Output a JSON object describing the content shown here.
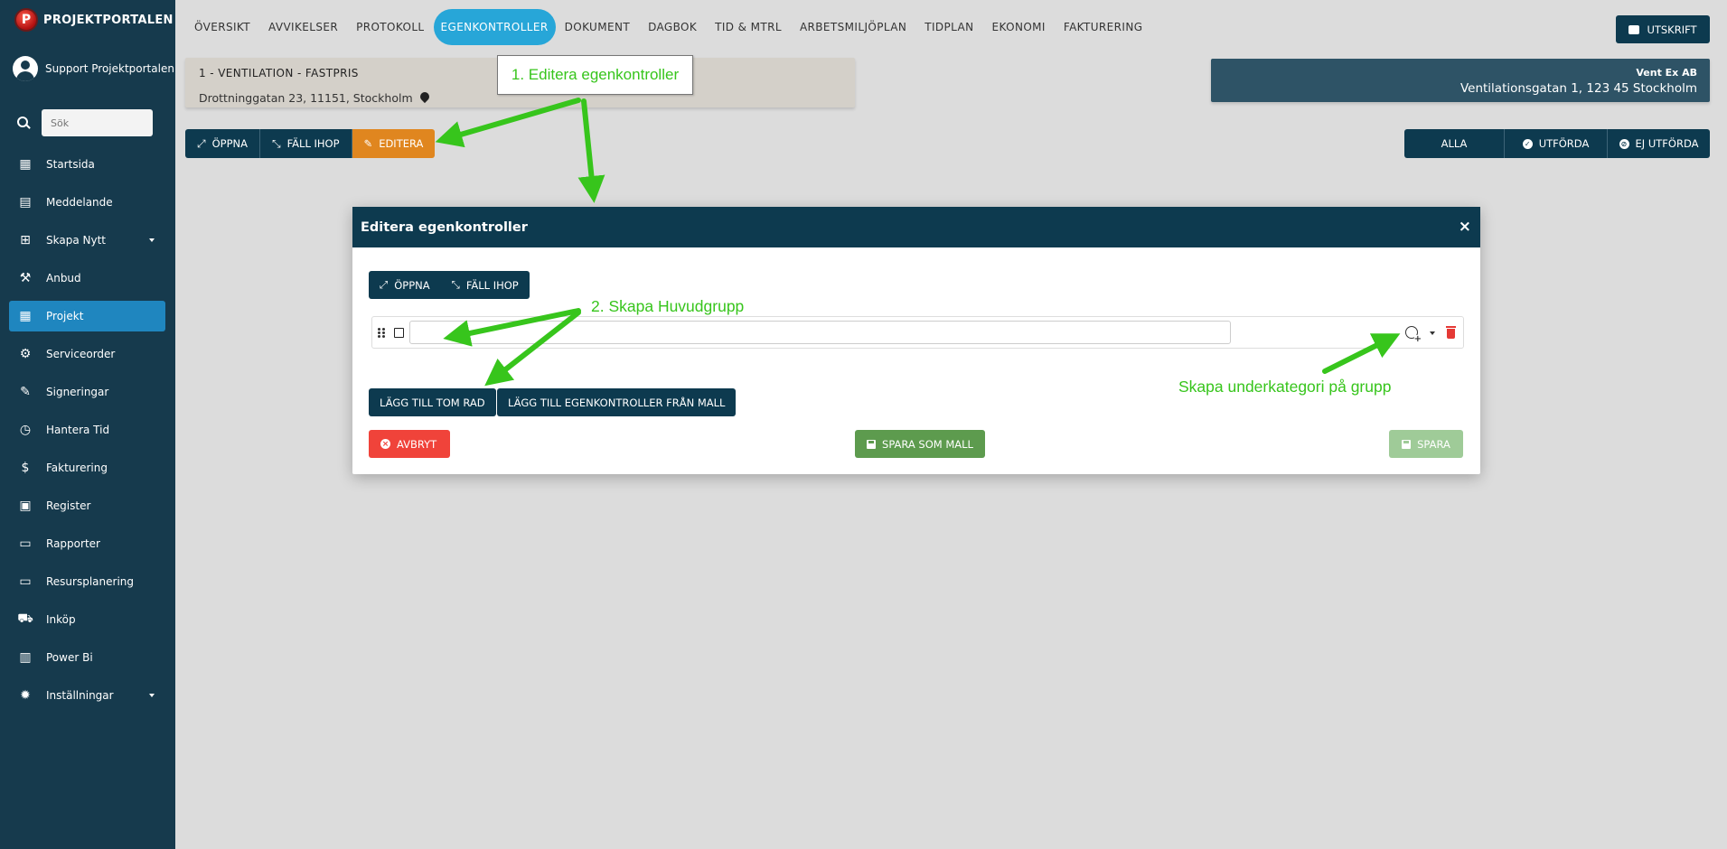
{
  "sidebar": {
    "brand": "PROJEKTPORTALEN",
    "user": "Support Projektportalen",
    "search_placeholder": "Sök",
    "items": [
      {
        "label": "Startsida",
        "icon": "dashboard-icon"
      },
      {
        "label": "Meddelande",
        "icon": "message-icon"
      },
      {
        "label": "Skapa Nytt",
        "icon": "add-box-icon",
        "dropdown": true
      },
      {
        "label": "Anbud",
        "icon": "gavel-icon"
      },
      {
        "label": "Projekt",
        "icon": "project-icon",
        "active": true
      },
      {
        "label": "Serviceorder",
        "icon": "wrench-icon"
      },
      {
        "label": "Signeringar",
        "icon": "pen-icon"
      },
      {
        "label": "Hantera Tid",
        "icon": "clock-icon"
      },
      {
        "label": "Fakturering",
        "icon": "dollar-icon"
      },
      {
        "label": "Register",
        "icon": "image-icon"
      },
      {
        "label": "Rapporter",
        "icon": "calendar-icon"
      },
      {
        "label": "Resursplanering",
        "icon": "calendar-icon"
      },
      {
        "label": "Inköp",
        "icon": "cart-icon"
      },
      {
        "label": "Power Bi",
        "icon": "chart-icon"
      },
      {
        "label": "Inställningar",
        "icon": "gear-icon",
        "dropdown": true
      }
    ]
  },
  "topnav": {
    "tabs": [
      "ÖVERSIKT",
      "AVVIKELSER",
      "PROTOKOLL",
      "EGENKONTROLLER",
      "DOKUMENT",
      "DAGBOK",
      "TID & MTRL",
      "ARBETSMILJÖPLAN",
      "TIDPLAN",
      "EKONOMI",
      "FAKTURERING"
    ],
    "active_tab": "EGENKONTROLLER",
    "print_label": "UTSKRIFT"
  },
  "project": {
    "title": "1 - VENTILATION - FASTPRIS",
    "address": "Drottninggatan 23, 11151, Stockholm"
  },
  "company": {
    "name": "Vent Ex AB",
    "address": "Ventilationsgatan 1, 123 45 Stockholm"
  },
  "actions": {
    "open": "ÖPPNA",
    "collapse": "FÄLL IHOP",
    "edit": "EDITERA"
  },
  "filters": {
    "all": "ALLA",
    "done": "UTFÖRDA",
    "not_done": "EJ UTFÖRDA"
  },
  "modal": {
    "title": "Editera egenkontroller",
    "close": "×",
    "open": "ÖPPNA",
    "collapse": "FÄLL IHOP",
    "row_value": "",
    "add_empty_row": "LÄGG TILL TOM RAD",
    "add_from_template": "LÄGG TILL EGENKONTROLLER FRÅN MALL",
    "cancel": "AVBRYT",
    "save_template": "SPARA SOM MALL",
    "save": "SPARA"
  },
  "annotations": {
    "step1": "1. Editera egenkontroller",
    "step2": "2. Skapa Huvudgrupp",
    "sub": "Skapa underkategori på grupp",
    "color": "#37c51c"
  },
  "colors": {
    "sidebar": "#163a4d",
    "primary": "#0d3a4f",
    "active_tab": "#27a6d8",
    "edit": "#e0861f",
    "cancel": "#f0433a",
    "template": "#5d9b4e",
    "save_disabled": "#9fcb98"
  }
}
